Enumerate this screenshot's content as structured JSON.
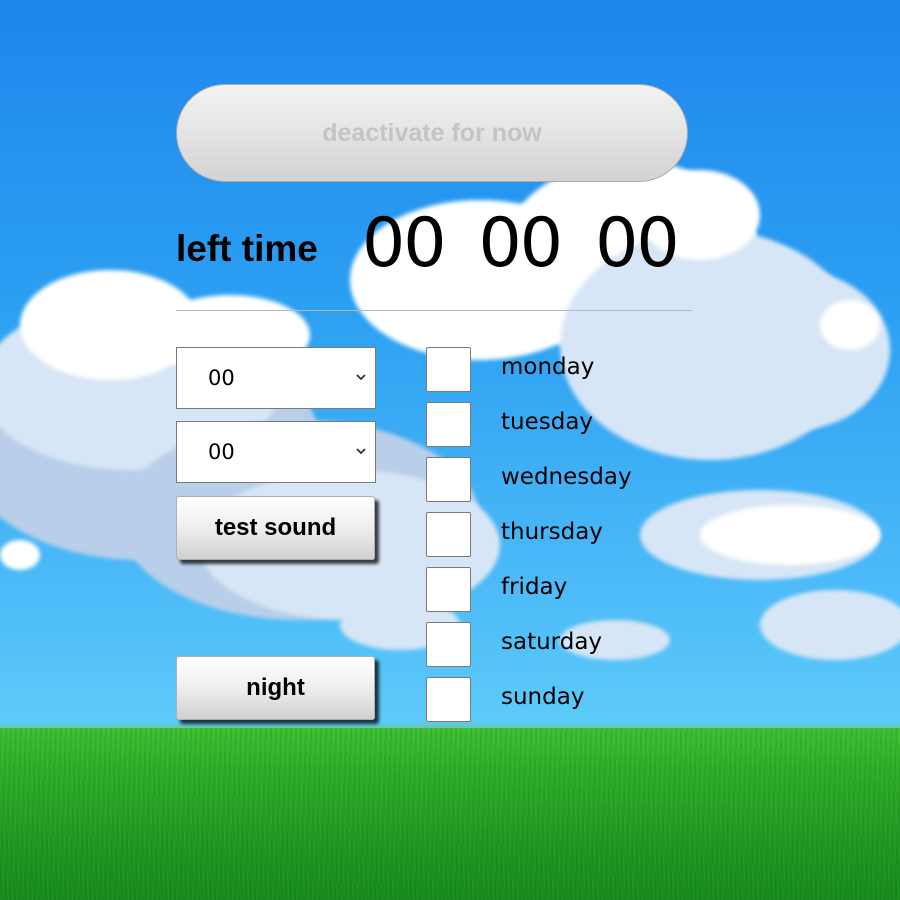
{
  "deactivate_button": {
    "label": "deactivate for now",
    "disabled": true
  },
  "left_time": {
    "label": "left time",
    "hours": "00",
    "minutes": "00",
    "seconds": "00"
  },
  "selects": {
    "hour": {
      "value": "00"
    },
    "minute": {
      "value": "00"
    }
  },
  "buttons": {
    "test_sound": "test sound",
    "night": "night"
  },
  "days": [
    {
      "label": "monday",
      "checked": false
    },
    {
      "label": "tuesday",
      "checked": false
    },
    {
      "label": "wednesday",
      "checked": false
    },
    {
      "label": "thursday",
      "checked": false
    },
    {
      "label": "friday",
      "checked": false
    },
    {
      "label": "saturday",
      "checked": false
    },
    {
      "label": "sunday",
      "checked": false
    }
  ],
  "icons": {
    "select_arrow": "chevron-down-icon"
  },
  "colors": {
    "sky": "#2b9cf0",
    "grass": "#2fae2a",
    "disabled_text": "#c4c4c4"
  }
}
